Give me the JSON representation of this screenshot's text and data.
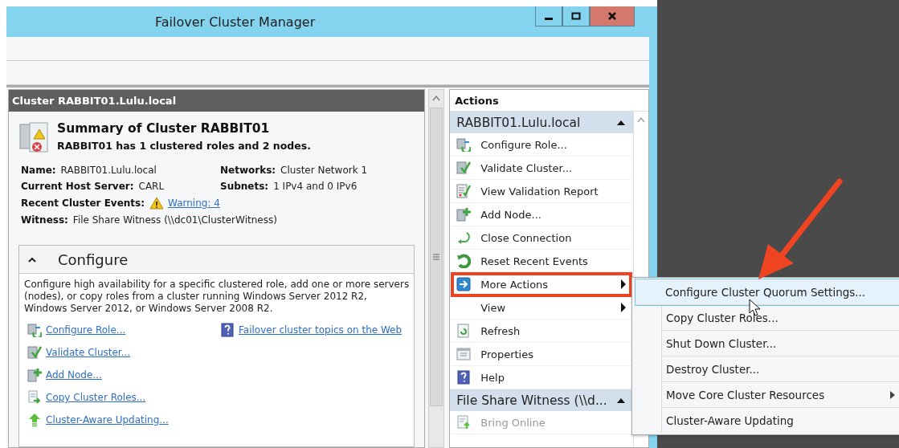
{
  "window": {
    "title": "Failover Cluster Manager"
  },
  "summary_pane": {
    "header": "Cluster RABBIT01.Lulu.local",
    "title": "Summary of Cluster RABBIT01",
    "subtitle": "RABBIT01 has 1 clustered roles and 2 nodes.",
    "fields": [
      {
        "label": "Name:",
        "value": "RABBIT01.Lulu.local"
      },
      {
        "label": "Networks:",
        "value": "Cluster Network 1"
      },
      {
        "label": "Current Host Server:",
        "value": "CARL"
      },
      {
        "label": "Subnets:",
        "value": "1 IPv4 and 0 IPv6"
      }
    ],
    "events": {
      "label": "Recent Cluster Events:",
      "link": "Warning: 4"
    },
    "witness": {
      "label": "Witness:",
      "value": "File Share Witness (\\\\dc01\\ClusterWitness)"
    },
    "configure": {
      "title": "Configure",
      "expanded": true,
      "description": "Configure high availability for a specific clustered role, add one or more servers (nodes), or copy roles from a cluster running Windows Server 2012 R2, Windows Server 2012, or Windows Server 2008 R2.",
      "links": [
        {
          "kind": "role",
          "label": "Configure Role..."
        },
        {
          "kind": "validate",
          "label": "Validate Cluster..."
        },
        {
          "kind": "node",
          "label": "Add Node..."
        },
        {
          "kind": "copy",
          "label": "Copy Cluster Roles..."
        },
        {
          "kind": "update",
          "label": "Cluster-Aware Updating..."
        }
      ],
      "help_link": "Failover cluster topics on the Web"
    }
  },
  "actions": {
    "title": "Actions",
    "groups": [
      {
        "title": "RABBIT01.Lulu.local",
        "expanded": true,
        "items": [
          {
            "kind": "role",
            "label": "Configure Role...",
            "submenu": false,
            "highlighted": false,
            "disabled": false
          },
          {
            "kind": "validate",
            "label": "Validate Cluster...",
            "submenu": false,
            "highlighted": false,
            "disabled": false
          },
          {
            "kind": "report",
            "label": "View Validation Report",
            "submenu": false,
            "highlighted": false,
            "disabled": false
          },
          {
            "kind": "node",
            "label": "Add Node...",
            "submenu": false,
            "highlighted": false,
            "disabled": false
          },
          {
            "kind": "close",
            "label": "Close Connection",
            "submenu": false,
            "highlighted": false,
            "disabled": false
          },
          {
            "kind": "reset",
            "label": "Reset Recent Events",
            "submenu": false,
            "highlighted": false,
            "disabled": false
          },
          {
            "kind": "more",
            "label": "More Actions",
            "submenu": true,
            "highlighted": true,
            "disabled": false
          },
          {
            "kind": "none",
            "label": "View",
            "submenu": true,
            "highlighted": false,
            "disabled": false
          },
          {
            "kind": "refresh",
            "label": "Refresh",
            "submenu": false,
            "highlighted": false,
            "disabled": false
          },
          {
            "kind": "properties",
            "label": "Properties",
            "submenu": false,
            "highlighted": false,
            "disabled": false
          },
          {
            "kind": "help",
            "label": "Help",
            "submenu": false,
            "highlighted": false,
            "disabled": false
          }
        ]
      },
      {
        "title": "File Share Witness (\\\\d...",
        "expanded": true,
        "items": [
          {
            "kind": "online",
            "label": "Bring Online",
            "submenu": false,
            "highlighted": false,
            "disabled": true
          }
        ]
      }
    ]
  },
  "submenu": {
    "items": [
      {
        "label": "Configure Cluster Quorum Settings...",
        "selected": true,
        "submenu": false
      },
      {
        "label": "Copy Cluster Roles...",
        "selected": false,
        "submenu": false
      },
      {
        "label": "Shut Down Cluster...",
        "selected": false,
        "submenu": false
      },
      {
        "label": "Destroy Cluster...",
        "selected": false,
        "submenu": false
      },
      {
        "label": "Move Core Cluster Resources",
        "selected": false,
        "submenu": true
      },
      {
        "label": "Cluster-Aware Updating",
        "selected": false,
        "submenu": false
      }
    ]
  }
}
